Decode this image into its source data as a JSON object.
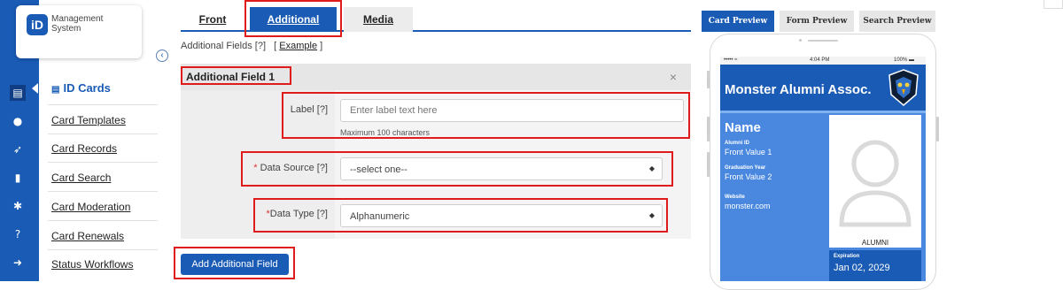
{
  "logo": {
    "line1": "Management",
    "line2": "System",
    "badge": "iD"
  },
  "rail_icons": [
    {
      "name": "id-card-icon",
      "glyph": "▤",
      "active": true
    },
    {
      "name": "chat-icon",
      "glyph": "●",
      "active": false
    },
    {
      "name": "rocket-icon",
      "glyph": "➶",
      "active": false
    },
    {
      "name": "document-icon",
      "glyph": "▮",
      "active": false
    },
    {
      "name": "gear-icon",
      "glyph": "✱",
      "active": false
    },
    {
      "name": "help-icon",
      "glyph": "?",
      "active": false
    },
    {
      "name": "sign-out-icon",
      "glyph": "➜",
      "active": false
    }
  ],
  "nav": {
    "heading": "ID Cards",
    "items": [
      "Card Templates",
      "Card Records",
      "Card Search",
      "Card Moderation",
      "Card Renewals",
      "Status Workflows"
    ]
  },
  "tabs": [
    {
      "label": "Front",
      "active": false
    },
    {
      "label": "Additional",
      "active": true
    },
    {
      "label": "Media",
      "active": false
    }
  ],
  "additional": {
    "label": "Additional Fields [?]",
    "example_open": "[",
    "example_link": "Example",
    "example_close": "]"
  },
  "field_panel": {
    "title": "Additional Field 1",
    "close": "×",
    "label_field": {
      "label": "Label [?]",
      "placeholder": "Enter label text here",
      "help": "Maximum 100 characters"
    },
    "data_source": {
      "required": "*",
      "label": "Data Source [?]",
      "value": "--select one--"
    },
    "data_type": {
      "required": "*",
      "label": "Data Type [?]",
      "value": "Alphanumeric"
    }
  },
  "add_button": "Add Additional Field",
  "preview_tabs": [
    {
      "label": "Card Preview",
      "active": true
    },
    {
      "label": "Form Preview",
      "active": false
    },
    {
      "label": "Search Preview",
      "active": false
    }
  ],
  "phone": {
    "status_signal": "••••• ≈",
    "status_time": "4:04 PM",
    "status_battery": "100% ▬"
  },
  "card": {
    "title": "Monster Alumni Assoc.",
    "name": "Name",
    "fields": [
      {
        "key": "Alumni ID",
        "value": "Front Value 1"
      },
      {
        "key": "Graduation Year",
        "value": "Front Value 2"
      },
      {
        "key": "Website",
        "value": "monster.com"
      }
    ],
    "photo_caption": "ALUMNI",
    "expiration_label": "Expiration",
    "expiration_value": "Jan 02, 2029"
  },
  "colors": {
    "primary": "#1a5bb5",
    "highlight": "#e01b1b",
    "card_body": "#4a88e0"
  }
}
